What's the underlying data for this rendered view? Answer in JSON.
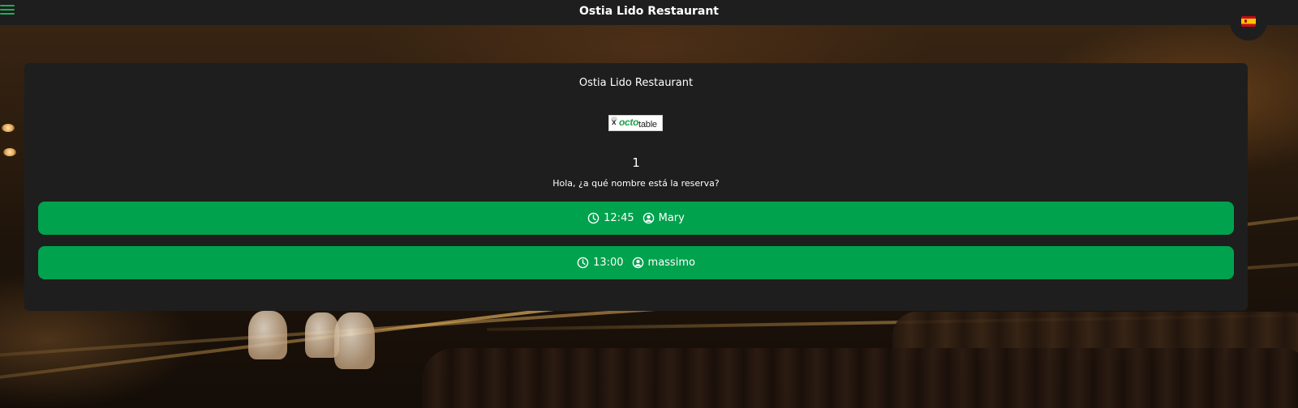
{
  "app": {
    "title": "Ostia Lido Restaurant"
  },
  "language": {
    "selected": "es",
    "icon": "spain-flag-icon"
  },
  "card": {
    "title": "Ostia Lido Restaurant",
    "logo_text": {
      "part1": "x",
      "part2": "octo",
      "part3": "table"
    },
    "number": "1",
    "question": "Hola, ¿a qué nombre está la reserva?",
    "reservations": [
      {
        "time": "12:45",
        "name": "Mary"
      },
      {
        "time": "13:00",
        "name": "massimo"
      }
    ]
  },
  "colors": {
    "accent": "#00a24d",
    "hamburger": "#19b15a",
    "surface": "#1e1e1e"
  }
}
